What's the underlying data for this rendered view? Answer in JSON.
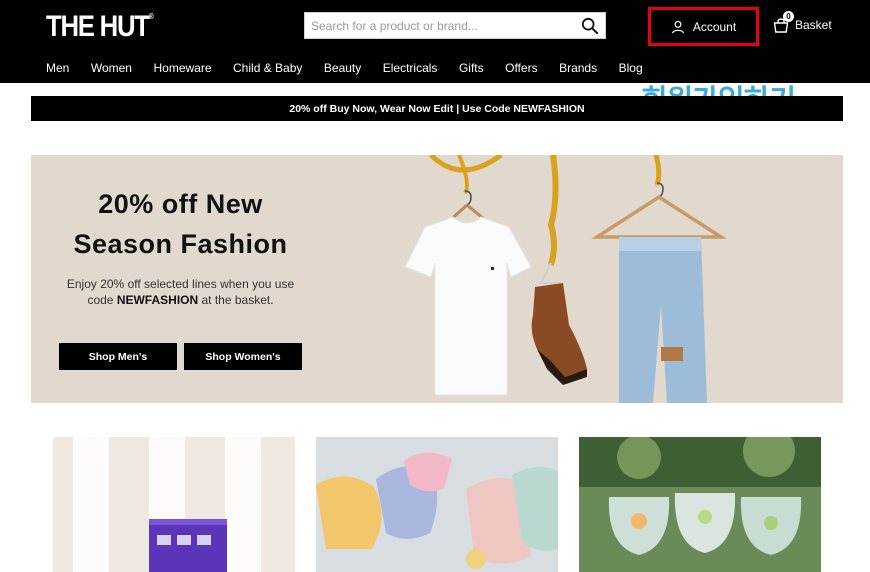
{
  "header": {
    "logo_text": "THE HUT",
    "logo_mark": "®",
    "search": {
      "placeholder": "Search for a product or brand..."
    },
    "account_label": "Account",
    "basket_label": "Basket",
    "basket_count": "0"
  },
  "nav": {
    "items": [
      "Men",
      "Women",
      "Homeware",
      "Child & Baby",
      "Beauty",
      "Electricals",
      "Gifts",
      "Offers",
      "Brands",
      "Blog"
    ]
  },
  "overlay": {
    "text": "회원가입하기"
  },
  "promo_bar": {
    "text": "20% off Buy Now, Wear Now Edit | Use Code NEWFASHION"
  },
  "hero": {
    "title_line1": "20% off New",
    "title_line2": "Season Fashion",
    "desc_part1": "Enjoy 20% off selected lines when you use",
    "desc_part2": "code",
    "desc_code": "NEWFASHION",
    "desc_part3": "at the basket.",
    "button_men": "Shop Men's",
    "button_women": "Shop Women's"
  },
  "colors": {
    "header_bg": "#000000",
    "highlight_border": "#e8000b",
    "overlay_text": "#3aa7e0",
    "hero_bg": "#e1d8ce"
  },
  "icons": {
    "search": "search-icon",
    "account": "user-icon",
    "basket": "basket-icon"
  }
}
